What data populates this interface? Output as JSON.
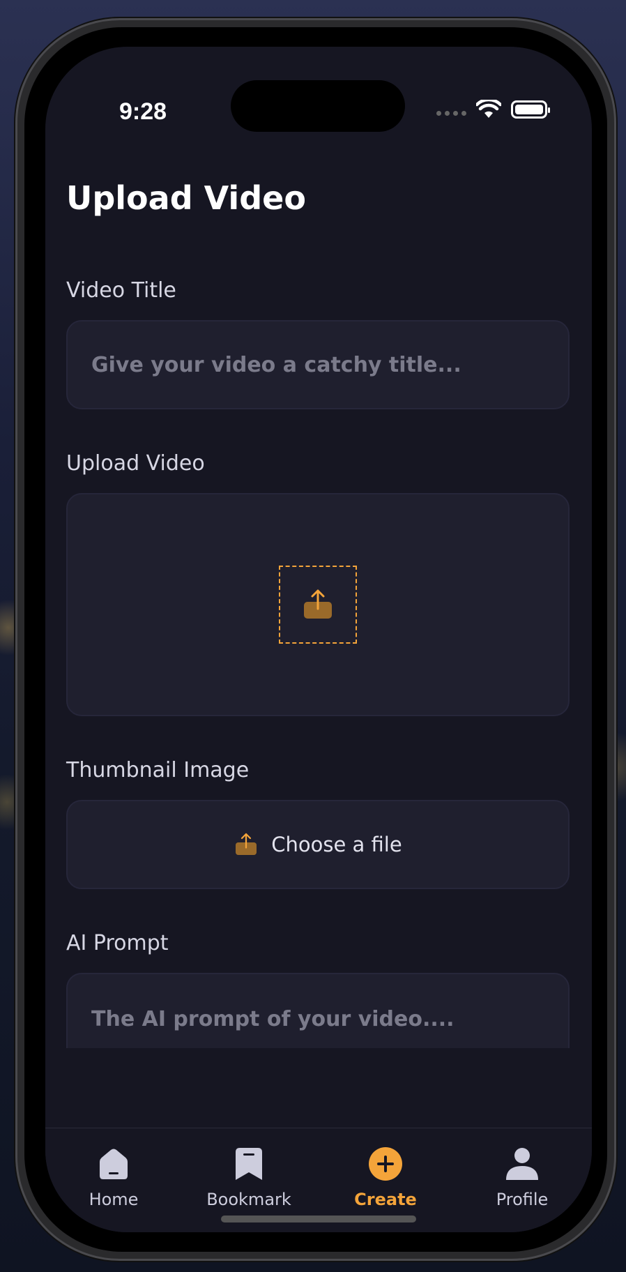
{
  "status_bar": {
    "time": "9:28"
  },
  "page": {
    "title": "Upload Video"
  },
  "form": {
    "video_title": {
      "label": "Video Title",
      "placeholder": "Give your video a catchy title..."
    },
    "upload_video": {
      "label": "Upload Video"
    },
    "thumbnail": {
      "label": "Thumbnail Image",
      "button_text": "Choose a file"
    },
    "ai_prompt": {
      "label": "AI Prompt",
      "placeholder": "The AI prompt of your video...."
    }
  },
  "tabs": [
    {
      "label": "Home",
      "icon": "home-icon",
      "active": false
    },
    {
      "label": "Bookmark",
      "icon": "bookmark-icon",
      "active": false
    },
    {
      "label": "Create",
      "icon": "plus-icon",
      "active": true
    },
    {
      "label": "Profile",
      "icon": "profile-icon",
      "active": false
    }
  ],
  "colors": {
    "accent": "#f4a43a",
    "background": "#161622",
    "field": "#1f1f2e"
  }
}
